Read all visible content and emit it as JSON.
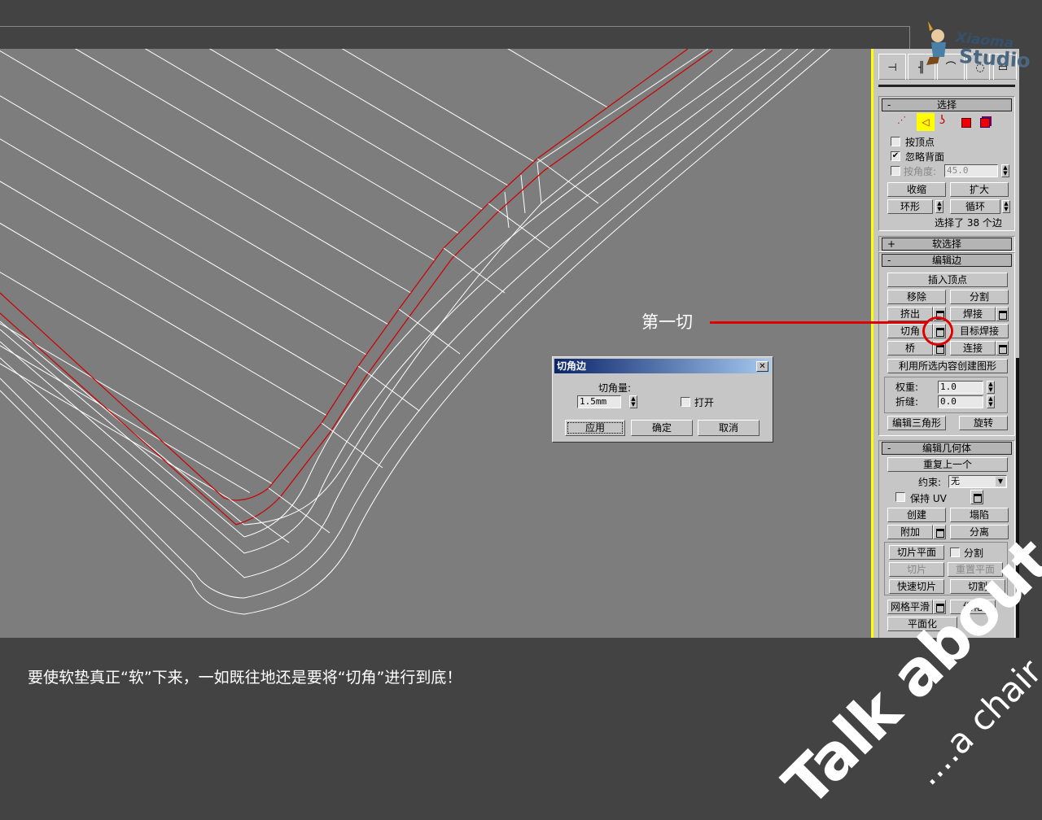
{
  "logo": {
    "line1": "Xiaoma",
    "line2": "Studio"
  },
  "annotation": "第一切",
  "caption": "要使软垫真正“软”下来，一如既往地还是要将“切角”进行到底！",
  "watermark": {
    "line1": "Talk about",
    "line2": "....a chair"
  },
  "dialog": {
    "title": "切角边",
    "amount_label": "切角量:",
    "amount_value": "1.5mm",
    "open_label": "打开",
    "apply": "应用",
    "ok": "确定",
    "cancel": "取消"
  },
  "panel": {
    "selection": {
      "title": "选择",
      "by_vertex": "按顶点",
      "ignore_backfacing": "忽略背面",
      "by_angle": "按角度:",
      "angle_value": "45.0",
      "shrink": "收缩",
      "grow": "扩大",
      "ring": "环形",
      "loop": "循环",
      "status": "选择了 38 个边"
    },
    "soft_selection": {
      "title": "软选择"
    },
    "edit_edges": {
      "title": "编辑边",
      "insert_vertex": "插入顶点",
      "remove": "移除",
      "split": "分割",
      "extrude": "挤出",
      "weld": "焊接",
      "chamfer": "切角",
      "target_weld": "目标焊接",
      "bridge": "桥",
      "connect": "连接",
      "create_shape": "利用所选内容创建图形",
      "weight_label": "权重:",
      "weight_value": "1.0",
      "crease_label": "折缝:",
      "crease_value": "0.0",
      "edit_tri": "编辑三角形",
      "turn": "旋转"
    },
    "edit_geometry": {
      "title": "编辑几何体",
      "repeat_last": "重复上一个",
      "constraints_label": "约束:",
      "constraints_value": "无",
      "preserve_uv": "保持 UV",
      "create": "创建",
      "collapse": "塌陷",
      "attach": "附加",
      "detach": "分离",
      "slice_plane": "切片平面",
      "split": "分割",
      "slice": "切片",
      "reset_plane": "重置平面",
      "quickslice": "快速切片",
      "cut": "切割",
      "meshsmooth": "网格平滑",
      "tessellate": "细化",
      "make_planar": "平面化"
    }
  },
  "colors": {
    "selected_edge": "#cc0000",
    "highlight": "#ffff00"
  }
}
